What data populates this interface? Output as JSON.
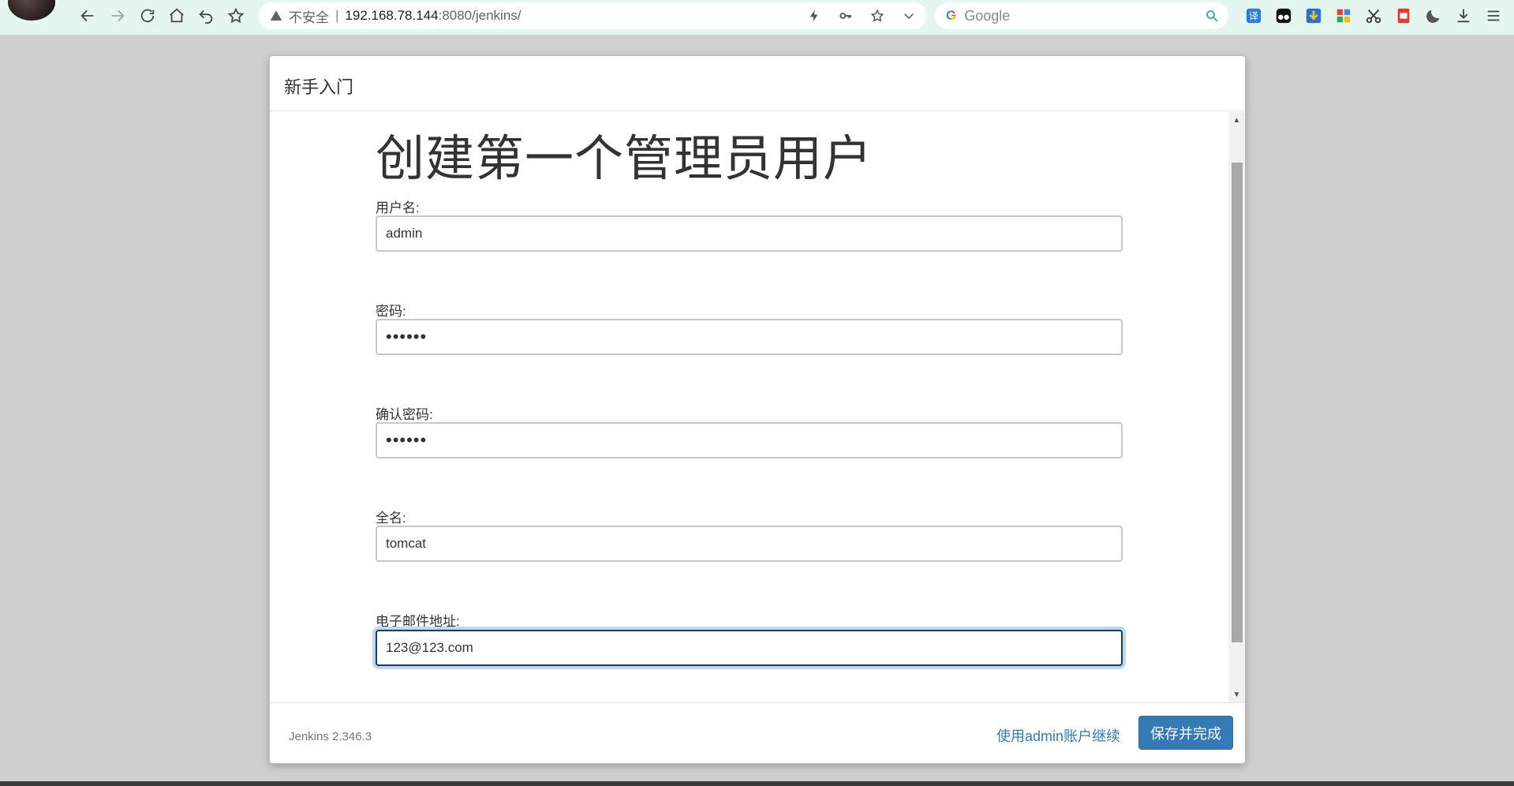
{
  "browser": {
    "insecure_label": "不安全",
    "separator": "|",
    "url_host": "192.168.78.144",
    "url_rest": ":8080/jenkins/",
    "search_placeholder": "Google"
  },
  "dialog": {
    "header_title": "新手入门",
    "page_title": "创建第一个管理员用户",
    "fields": {
      "username": {
        "label": "用户名:",
        "value": "admin"
      },
      "password": {
        "label": "密码:",
        "value": "••••••"
      },
      "confirm_password": {
        "label": "确认密码:",
        "value": "••••••"
      },
      "fullname": {
        "label": "全名:",
        "value": "tomcat"
      },
      "email": {
        "label": "电子邮件地址:",
        "value": "123@123.com"
      }
    },
    "footer": {
      "version": "Jenkins 2.346.3",
      "continue_link": "使用admin账户继续",
      "save_button": "保存并完成"
    }
  },
  "colors": {
    "toolbar_bg": "#e5f5ef",
    "primary": "#337ab7",
    "focus_border": "#173a5e"
  }
}
